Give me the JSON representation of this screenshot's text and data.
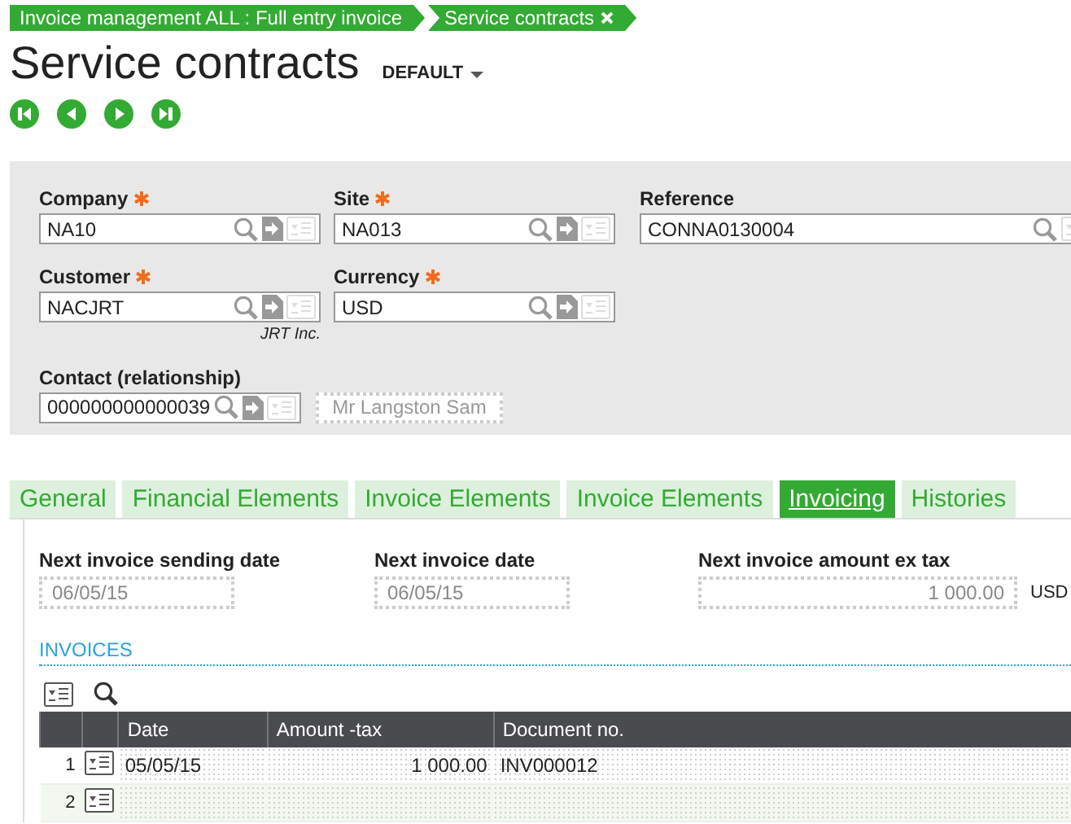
{
  "breadcrumbs": [
    {
      "label": "Invoice management ALL : Full entry invoice",
      "closable": false
    },
    {
      "label": "Service contracts",
      "closable": true
    }
  ],
  "page_title": "Service contracts",
  "view_selector": "DEFAULT",
  "header_rows": [
    [
      {
        "label": "Company",
        "required": true,
        "value": "NA10",
        "kind": "lookup"
      },
      {
        "label": "Site",
        "required": true,
        "value": "NA013",
        "kind": "lookup"
      },
      {
        "label": "Reference",
        "required": false,
        "value": "CONNA0130004",
        "kind": "wide"
      }
    ],
    [
      {
        "label": "Customer",
        "required": true,
        "value": "NACJRT",
        "kind": "lookup",
        "caption": "JRT Inc."
      },
      {
        "label": "Currency",
        "required": true,
        "value": "USD",
        "kind": "lookup"
      }
    ],
    [
      {
        "label": "Contact (relationship)",
        "required": false,
        "value": "000000000000039",
        "kind": "lookup",
        "display": "Mr Langston Sam"
      }
    ]
  ],
  "tabs": [
    {
      "label": "General",
      "selected": false
    },
    {
      "label": "Financial Elements",
      "selected": false
    },
    {
      "label": "Invoice Elements",
      "selected": false
    },
    {
      "label": "Invoice Elements",
      "selected": false
    },
    {
      "label": "Invoicing",
      "selected": true
    },
    {
      "label": "Histories",
      "selected": false
    }
  ],
  "invoicing_fields": [
    {
      "label": "Next invoice sending date",
      "value": "06/05/15",
      "kind": "date"
    },
    {
      "label": "Next invoice date",
      "value": "06/05/15",
      "kind": "date"
    },
    {
      "label": "Next invoice amount ex tax",
      "value": "1 000.00",
      "kind": "amount",
      "unit": "USD"
    }
  ],
  "invoices": {
    "title": "INVOICES",
    "columns": [
      "Date",
      "Amount -tax",
      "Document no."
    ],
    "rows": [
      {
        "number": "1",
        "date": "05/05/15",
        "amount": "1 000.00",
        "document": "INV000012"
      },
      {
        "number": "2"
      }
    ]
  }
}
